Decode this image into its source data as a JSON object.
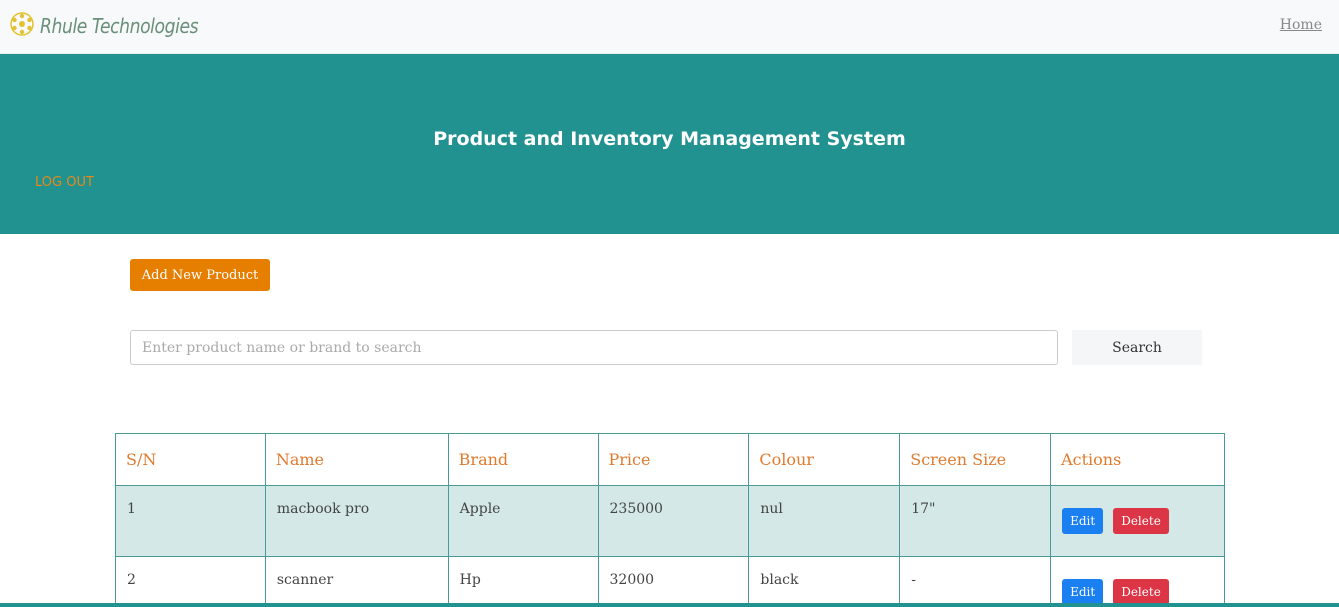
{
  "nav": {
    "brand": "Rhule Technologies",
    "home": "Home"
  },
  "hero": {
    "title": "Product and Inventory Management System",
    "logout": "LOG OUT"
  },
  "actions": {
    "add_product": "Add New Product"
  },
  "search": {
    "placeholder": "Enter product name or brand to search",
    "button": "Search"
  },
  "table": {
    "headers": [
      "S/N",
      "Name",
      "Brand",
      "Price",
      "Colour",
      "Screen Size",
      "Actions"
    ],
    "rows": [
      {
        "sn": "1",
        "name": "macbook pro",
        "brand": "Apple",
        "price": "235000",
        "colour": "nul",
        "screen": "17\""
      },
      {
        "sn": "2",
        "name": "scanner",
        "brand": "Hp",
        "price": "32000",
        "colour": "black",
        "screen": "-"
      }
    ],
    "edit_label": "Edit",
    "delete_label": "Delete"
  },
  "colors": {
    "accent": "#229290",
    "orange": "#e67e00",
    "edit": "#1a7ff0",
    "delete": "#dc3545"
  }
}
